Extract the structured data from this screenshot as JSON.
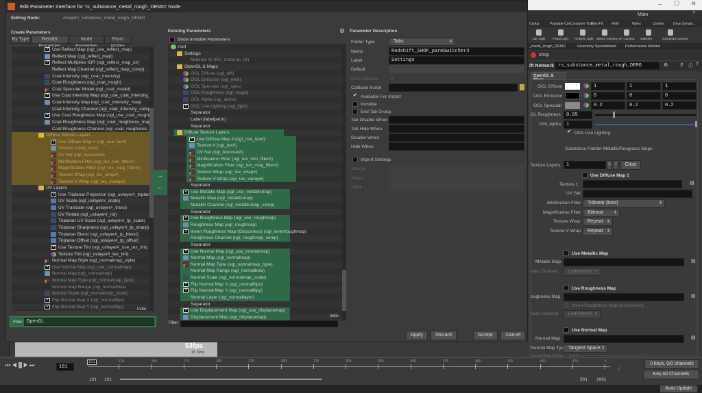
{
  "window": {
    "title": "Edit Parameter Interface for 'rs_substance_metal_rough_DEMO' Node",
    "editing_label": "Editing Node:",
    "editing_path": "/shop/rs_substance_metal_rough_DEMO"
  },
  "create": {
    "title": "Create Parameters",
    "tabs": [
      "By Type",
      "Render Properties",
      "Node Properties",
      "From Nodes"
    ],
    "items": [
      {
        "label": "Use Reflect Map (ogl_use_reflect_map)",
        "icon": "check",
        "level": 2
      },
      {
        "label": "Reflect Map (ogl_reflect_map)",
        "icon": "file",
        "level": 2
      },
      {
        "label": "Reflect Multiplies IOR (ogl_reflect_map_ior)",
        "icon": "check",
        "level": 2
      },
      {
        "label": "Reflect Map Channel (ogl_reflect_map_comp)",
        "icon": "none",
        "level": 2
      },
      {
        "label": "Coat Intensity (ogl_coat_intensity)",
        "icon": "float",
        "level": 2
      },
      {
        "label": "Coat Roughness (ogl_coat_rough)",
        "icon": "float",
        "level": 2
      },
      {
        "label": "Coat Specular Model (ogl_coat_model)",
        "icon": "menu",
        "level": 2
      },
      {
        "label": "Use Coat Intensity Map (ogl_use_coat_intensity_map)",
        "icon": "check",
        "level": 2
      },
      {
        "label": "Coat Intensity Map (ogl_coat_intensity_map)",
        "icon": "file",
        "level": 2
      },
      {
        "label": "Coat Intensity Channel (ogl_coat_intensity_comp)",
        "icon": "none",
        "level": 2
      },
      {
        "label": "Use Coat Roughness Map (ogl_use_coat_roughness_ma",
        "icon": "check",
        "level": 2
      },
      {
        "label": "Coat Roughness Map (ogl_coat_roughness_map)",
        "icon": "file",
        "level": 2
      },
      {
        "label": "Coat Roughness Channel (ogl_coat_roughness_comp)",
        "icon": "none",
        "level": 2
      },
      {
        "label": "Diffuse Texture Layers",
        "icon": "folder",
        "level": 1,
        "selected": true
      },
      {
        "label": "Use Diffuse Map # (ogl_use_tex#)",
        "icon": "check",
        "level": 3,
        "selected": true
      },
      {
        "label": "Texture # (ogl_tex#)",
        "icon": "file",
        "level": 3,
        "selected": true
      },
      {
        "label": "UV Set (ogl_texuvset#)",
        "icon": "menu",
        "level": 3,
        "selected": true
      },
      {
        "label": "Minification Filter (ogl_tex_min_filter#)",
        "icon": "menu",
        "level": 3,
        "selected": true
      },
      {
        "label": "Magnification Filter (ogl_tex_mag_filter#)",
        "icon": "menu",
        "level": 3,
        "selected": true
      },
      {
        "label": "Texture Wrap (ogl_tex_wrap#)",
        "icon": "menu",
        "level": 3,
        "selected": true
      },
      {
        "label": "Texture V Wrap (ogl_tex_vwrap#)",
        "icon": "menu",
        "level": 3,
        "selected": true
      },
      {
        "label": "UV Layers",
        "icon": "folder",
        "level": 1
      },
      {
        "label": "Use Triplanar Projection (ogl_uvlayer#_triplanar)",
        "icon": "check",
        "level": 3
      },
      {
        "label": "UV Scale (ogl_uvlayer#_scale)",
        "icon": "vector",
        "level": 3
      },
      {
        "label": "UV Translate (ogl_uvlayer#_trans)",
        "icon": "vector",
        "level": 3
      },
      {
        "label": "UV Rotate (ogl_uvlayer#_rot)",
        "icon": "float",
        "level": 3
      },
      {
        "label": "Triplanar UV Scale (ogl_uvlayer#_tp_scale)",
        "icon": "float",
        "level": 3
      },
      {
        "label": "Triplanar Sharpness (ogl_uvlayer#_tp_sharp)",
        "icon": "float",
        "level": 3
      },
      {
        "label": "Triplanar Blend (ogl_uvlayer#_tp_blend)",
        "icon": "vector",
        "level": 3
      },
      {
        "label": "Triplanar Offset (ogl_uvlayer#_tp_offset)",
        "icon": "vector",
        "level": 3
      },
      {
        "label": "Use Texture Tint (ogl_uvlayer#_use_tex_tint)",
        "icon": "check",
        "level": 3
      },
      {
        "label": "Texture Tint (ogl_uvlayer#_tex_tint)",
        "icon": "color",
        "level": 3
      },
      {
        "label": "Normal Map Style (ogl_normalmap_style)",
        "icon": "menu",
        "level": 2
      },
      {
        "label": "Use Normal Map (ogl_use_normalmap)",
        "icon": "check",
        "level": 2,
        "dim": true
      },
      {
        "label": "Normal Map (ogl_normalmap)",
        "icon": "file",
        "level": 2,
        "dim": true
      },
      {
        "label": "Normal Map Type (ogl_normalmap_type)",
        "icon": "menu",
        "level": 2,
        "dim": true
      },
      {
        "label": "Normal Map Range (ogl_normalbias)",
        "icon": "none",
        "level": 2,
        "dim": true
      },
      {
        "label": "Normal Scale (ogl_normalmap_scale)",
        "icon": "float",
        "level": 2,
        "dim": true
      },
      {
        "label": "Flip Normal Map X (ogl_normalflipx)",
        "icon": "check",
        "level": 2,
        "dim": true
      },
      {
        "label": "Flip Normal Map Y (ogl_normalflipy)",
        "icon": "check",
        "level": 2,
        "dim": true
      }
    ],
    "indie": "Indie",
    "filter_label": "Filter",
    "filter_value": "OpenGL"
  },
  "existing": {
    "title": "Existing Parameters",
    "show_invisible": "Show Invisible Parameters",
    "items": [
      {
        "label": "root",
        "icon": "root",
        "level": 0
      },
      {
        "label": "Settings",
        "icon": "folder",
        "level": 1
      },
      {
        "label": "Material ID (RS_matprop_ID)",
        "icon": "none",
        "level": 2,
        "dim": true
      },
      {
        "label": "OpenGL & Maps",
        "icon": "folder",
        "level": 1
      },
      {
        "label": "OGL Diffuse (ogl_diff)",
        "icon": "color",
        "level": 2,
        "dim": true
      },
      {
        "label": "OGL Emission (ogl_emit)",
        "icon": "color",
        "level": 2,
        "dim": true
      },
      {
        "label": "OGL Specular (ogl_spec)",
        "icon": "color",
        "level": 2,
        "dim": true
      },
      {
        "label": "OGL Roughness (ogl_rough)",
        "icon": "float",
        "level": 2,
        "dim": true
      },
      {
        "label": "OGL Alpha (ogl_alpha)",
        "icon": "float",
        "level": 2,
        "dim": true
      },
      {
        "label": "OGL Use Lighting (ogl_light)",
        "icon": "check",
        "level": 2,
        "dim": true
      },
      {
        "label": "Separator",
        "icon": "none",
        "level": 2
      },
      {
        "label": "Label (labelparm)",
        "icon": "none",
        "level": 2
      },
      {
        "label": "Separator",
        "icon": "none",
        "level": 2
      },
      {
        "label": "Diffuse Texture Layers",
        "icon": "folder",
        "level": 1,
        "hl": true
      },
      {
        "label": "Use Diffuse Map # (ogl_use_tex#)",
        "icon": "check",
        "level": 3,
        "hl": true
      },
      {
        "label": "Texture # (ogl_tex#)",
        "icon": "file",
        "level": 3,
        "hl": true
      },
      {
        "label": "UV Set (ogl_texuvset#)",
        "icon": "menu",
        "level": 3,
        "hl": true
      },
      {
        "label": "Minification Filter (ogl_tex_min_filter#)",
        "icon": "menu",
        "level": 3,
        "hl": true
      },
      {
        "label": "Magnification Filter (ogl_tex_mag_filter#)",
        "icon": "menu",
        "level": 3,
        "hl": true
      },
      {
        "label": "Texture Wrap (ogl_tex_wrap#)",
        "icon": "menu",
        "level": 3,
        "hl": true
      },
      {
        "label": "Texture V Wrap (ogl_tex_vwrap#)",
        "icon": "menu",
        "level": 3,
        "hl": true
      },
      {
        "label": "Separator",
        "icon": "none",
        "level": 2
      },
      {
        "label": "Use Metallic Map (ogl_use_metallicmap)",
        "icon": "check",
        "level": 2,
        "hl": true
      },
      {
        "label": "Metallic Map (ogl_metallicmap)",
        "icon": "file",
        "level": 2,
        "hl": true
      },
      {
        "label": "Metallic Channel (ogl_metallicmap_comp)",
        "icon": "none",
        "level": 2,
        "hl": true
      },
      {
        "label": "Separator",
        "icon": "none",
        "level": 2
      },
      {
        "label": "Use Roughness Map (ogl_use_roughmap)",
        "icon": "check",
        "level": 2,
        "hl": true
      },
      {
        "label": "Roughness Map (ogl_roughmap)",
        "icon": "file",
        "level": 2,
        "hl": true
      },
      {
        "label": "Invert Roughness Map (Glossiness) (ogl_invertroughmap)",
        "icon": "check",
        "level": 2,
        "hl": true
      },
      {
        "label": "Roughness Channel (ogl_roughmap_comp)",
        "icon": "none",
        "level": 2,
        "hl": true
      },
      {
        "label": "Separator",
        "icon": "none",
        "level": 2
      },
      {
        "label": "Use Normal Map (ogl_use_normalmap)",
        "icon": "check",
        "level": 2,
        "hl": true
      },
      {
        "label": "Normal Map (ogl_normalmap)",
        "icon": "file",
        "level": 2,
        "hl": true
      },
      {
        "label": "Normal Map Type (ogl_normalmap_type)",
        "icon": "menu",
        "level": 2,
        "hl": true
      },
      {
        "label": "Normal Map Range (ogl_normalbias)",
        "icon": "none",
        "level": 2,
        "hl": true
      },
      {
        "label": "Normal Scale (ogl_normalmap_scale)",
        "icon": "float",
        "level": 2,
        "hl": true
      },
      {
        "label": "Flip Normal Map X (ogl_normalflipx)",
        "icon": "check",
        "level": 2,
        "hl": true
      },
      {
        "label": "Flip Normal Map Y (ogl_normalflipy)",
        "icon": "check",
        "level": 2,
        "hl": true
      },
      {
        "label": "Normal Layer (ogl_normallayer)",
        "icon": "none",
        "level": 2,
        "hl": true
      },
      {
        "label": "Separator",
        "icon": "none",
        "level": 2
      },
      {
        "label": "Use Displacement Map (ogl_use_displacemap)",
        "icon": "check",
        "level": 2,
        "hl": true
      },
      {
        "label": "Displacement Map (ogl_displacemap)",
        "icon": "file",
        "level": 2,
        "hl": true
      }
    ],
    "indie": "Indie",
    "filter_label": "Filter",
    "filter_value": ""
  },
  "desc": {
    "title": "Parameter Description",
    "folder_type_label": "Folder Type",
    "folder_type": "Tabs",
    "name_label": "Name",
    "name": "Redshift_SHOP_parmSwitcher3",
    "label_label": "Label",
    "label": "Settings",
    "default_label": "Default",
    "first_instance_label": "First Instance",
    "first_instance": "1",
    "callback_label": "Callback Script",
    "available": "Available For Import",
    "invisible": "Invisible",
    "end_tab": "End Tab Group",
    "tab_disable": "Tab Disable When",
    "tab_hide": "Tab Hide When",
    "disable_when": "Disable When",
    "hide_when": "Hide When",
    "import_settings": "Import Settings",
    "source": "Source",
    "token": "Token",
    "mask": "Mask"
  },
  "buttons": {
    "apply": "Apply",
    "discard": "Discard",
    "accept": "Accept",
    "cancel": "Cancel"
  },
  "right": {
    "desktop": "Main",
    "shelf_tabs": [
      "Contai",
      "Populate Con",
      "Container Tools",
      "Pyro FX",
      "FEM",
      "Wires",
      "Crowds",
      "Drive Simula..."
    ],
    "shelf_tools": [
      "...stic Light",
      "Portal Light",
      "Ambient Light",
      "Stereo Camera",
      "VR Camera",
      "Switcher",
      "Gamepad Camera"
    ],
    "pane_tabs": [
      "_metal_rough_DEMO",
      "Geometry Spreadsheet",
      "Performance Monitor"
    ],
    "path": "shop",
    "network_label": "ift Network",
    "node_name": "rs_substance_metal_rough_DEMO",
    "folder_tab": "OpenGL & Maps",
    "ogl_diffuse_label": "OGL Diffuse",
    "ogl_diffuse": [
      "1",
      "1",
      "1"
    ],
    "ogl_emission_label": "OGL Emission",
    "ogl_emission": [
      "0",
      "0",
      "0"
    ],
    "ogl_specular_label": "OGL Specular",
    "ogl_specular": [
      "0.2",
      "0.2",
      "0.2"
    ],
    "roughness_label": "GL Roughness",
    "roughness": "0.05",
    "roughness_fraction": 0.05,
    "alpha_label": "OGL Alpha",
    "alpha": "1",
    "alpha_fraction": 1.0,
    "use_lighting": "OGL Use Lighting",
    "section": "Substance Painter Metallic/Rougness Maps",
    "texture_layers_label": "Texture Layers",
    "texture_layers": "1",
    "clear": "Clear",
    "use_diffuse": "Use Diffuse Map 1",
    "texture1": "Texture 1",
    "uvset": "UV Set",
    "min_filter_label": "Minification Filter",
    "min_filter": "Trilinear (best)",
    "mag_filter_label": "Magnification Filter",
    "mag_filter": "Bilinear",
    "wrap_label": "Texture Wrap",
    "wrap": "Repeat",
    "vwrap_label": "Texture V Wrap",
    "vwrap": "Repeat",
    "use_metallic": "Use Metallic Map",
    "metallic_map": "Metallic Map",
    "metallic_channel_label": "tallic Channel",
    "metallic_channel": "Luminance",
    "use_roughness": "Use Roughness Map",
    "roughness_map": "oughness Map",
    "invert_rough": "Invert Roughness Map (Glossiness)",
    "rough_channel_label": "ness Channel",
    "rough_channel": "Luminance",
    "use_normal": "Use Normal Map",
    "normal_map": "Normal Map",
    "normal_type_label": "Normal Map Type",
    "normal_type": "Tangent Space",
    "normal_range_label": "Normal Map Range",
    "normal_range": "0 to 1"
  },
  "viewport": {
    "fps": "53fps",
    "ms": "18.70ms"
  },
  "timeline": {
    "frame": "101",
    "marker": "101",
    "ticks": [
      "125",
      "150",
      "175",
      "200",
      "225",
      "250",
      "275",
      "300",
      "325",
      "350",
      "375",
      "400",
      "425",
      "450",
      "475",
      "5"
    ],
    "range_start": "101",
    "range_start2": "101",
    "range_end": "501",
    "range_end2": "1001",
    "keys": "0 keys, 0/0 channels",
    "key_all": "Key All Channels",
    "auto_update": "Auto Update"
  }
}
